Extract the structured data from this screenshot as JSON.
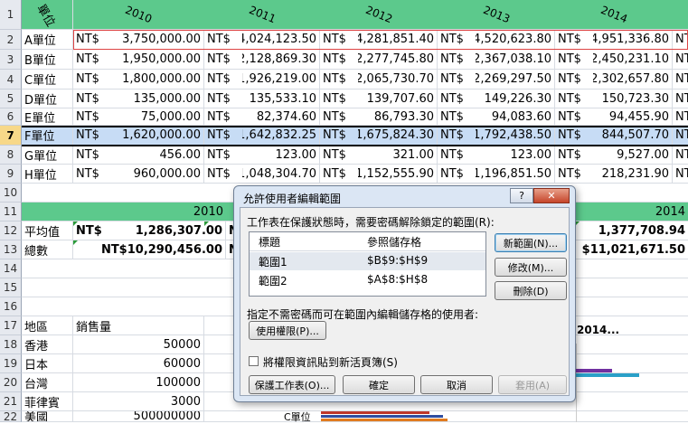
{
  "years": [
    "2010",
    "2011",
    "2012",
    "2013",
    "2014"
  ],
  "header_label": "單位",
  "row_numbers": [
    "1",
    "2",
    "3",
    "4",
    "5",
    "6",
    "7",
    "8",
    "9",
    "10",
    "11",
    "12",
    "13",
    "14",
    "15",
    "16",
    "17",
    "18",
    "19",
    "20",
    "21",
    "22"
  ],
  "currency": "NT$",
  "units": [
    {
      "name": "A單位",
      "values": [
        "3,750,000.00",
        "4,024,123.50",
        "4,281,851.40",
        "4,520,623.80",
        "4,951,336.80"
      ]
    },
    {
      "name": "B單位",
      "values": [
        "1,950,000.00",
        "2,128,869.30",
        "2,277,745.80",
        "2,367,038.10",
        "2,450,231.10"
      ]
    },
    {
      "name": "C單位",
      "values": [
        "1,800,000.00",
        "1,926,219.00",
        "2,065,730.70",
        "2,269,297.50",
        "2,302,657.80"
      ]
    },
    {
      "name": "D單位",
      "values": [
        "135,000.00",
        "135,533.10",
        "139,707.60",
        "149,226.30",
        "150,723.30"
      ]
    },
    {
      "name": "E單位",
      "values": [
        "75,000.00",
        "82,374.60",
        "86,793.30",
        "94,083.60",
        "94,455.90"
      ]
    },
    {
      "name": "F單位",
      "values": [
        "1,620,000.00",
        "1,642,832.25",
        "1,675,824.30",
        "1,792,438.50",
        "844,507.70"
      ]
    },
    {
      "name": "G單位",
      "values": [
        "456.00",
        "123.00",
        "321.00",
        "123.00",
        "9,527.00"
      ]
    },
    {
      "name": "H單位",
      "values": [
        "960,000.00",
        "1,048,304.70",
        "1,152,555.90",
        "1,196,851.50",
        "218,231.90"
      ]
    }
  ],
  "summary": {
    "year_left": "2010",
    "year_right": "2014",
    "avg_label": "平均值",
    "avg_cur": "NT$",
    "avg_left": "1,286,307.00",
    "avg_right": "1,377,708.94",
    "avg_partial": "NT$",
    "total_label": "總數",
    "total_left": "NT$10,290,456.00",
    "total_right": "NT$11,021,671.50",
    "total_partial": "NT$"
  },
  "sales": {
    "header_region": "地區",
    "header_amount": "銷售量",
    "rows": [
      {
        "region": "香港",
        "amount": "50000"
      },
      {
        "region": "日本",
        "amount": "60000"
      },
      {
        "region": "台灣",
        "amount": "100000"
      },
      {
        "region": "菲律賓",
        "amount": "3000"
      },
      {
        "region": "美國",
        "amount": "500000000"
      }
    ]
  },
  "chart_fragment": {
    "title_partial": "2014...",
    "axis_label_partial": "C單位",
    "colors": [
      "#7030a0",
      "#2aa0c8",
      "#c0392b",
      "#2f4ea0",
      "#e07b1f"
    ]
  },
  "dialog": {
    "title": "允許使用者編輯範圍",
    "help": "?",
    "close": "✕",
    "prompt": "工作表在保護狀態時，需要密碼解除鎖定的範圍(R):",
    "col_title": "標題",
    "col_ref": "參照儲存格",
    "ranges": [
      {
        "title": "範圍1",
        "ref": "$B$9:$H$9"
      },
      {
        "title": "範圍2",
        "ref": "$A$8:$H$8"
      }
    ],
    "btn_new": "新範圍(N)...",
    "btn_modify": "修改(M)...",
    "btn_delete": "刪除(D)",
    "users_label": "指定不需密碼而可在範圍內編輯儲存格的使用者:",
    "btn_perms": "使用權限(P)...",
    "paste_label": "將權限資訊貼到新活頁簿(S)",
    "btn_protect": "保護工作表(O)...",
    "btn_ok": "確定",
    "btn_cancel": "取消",
    "btn_apply": "套用(A)"
  }
}
